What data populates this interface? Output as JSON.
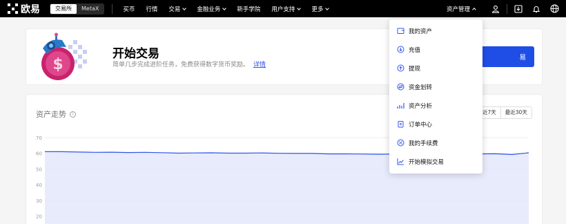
{
  "nav": {
    "logo_text": "欧易",
    "segments": [
      "交易所",
      "MetaX"
    ],
    "items": [
      {
        "label": "买币",
        "caret": false
      },
      {
        "label": "行情",
        "caret": false
      },
      {
        "label": "交易",
        "caret": true
      },
      {
        "label": "金融业务",
        "caret": true
      },
      {
        "label": "新手学院",
        "caret": false
      },
      {
        "label": "用户支持",
        "caret": true
      },
      {
        "label": "更多",
        "caret": true
      }
    ],
    "asset_menu_label": "资产管理"
  },
  "banner": {
    "title": "开始交易",
    "subtitle": "简单几步完成进阶任务，免费获得数字货币奖励。",
    "link": "详情",
    "cta_label": "易"
  },
  "chart_section": {
    "title": "资产走势",
    "info_icon": "i",
    "range_buttons": [
      "近7天",
      "最近30天"
    ]
  },
  "chart_data": {
    "type": "area",
    "title": "资产走势",
    "xlabel": "",
    "ylabel": "",
    "yticks": [
      70,
      60,
      50,
      40,
      30,
      20
    ],
    "ylim": [
      15,
      70
    ],
    "grid": true,
    "x": [
      0,
      1,
      2,
      3,
      4,
      5,
      6,
      7,
      8,
      9,
      10,
      11,
      12,
      13,
      14,
      15,
      16,
      17,
      18,
      19,
      20,
      21,
      22,
      23,
      24,
      25,
      26,
      27,
      28,
      29
    ],
    "series": [
      {
        "values": [
          61,
          61,
          60.8,
          60.6,
          60.7,
          60.5,
          60.6,
          60.4,
          60.1,
          60.2,
          60.3,
          60.1,
          60.1,
          60.2,
          60.0,
          59.9,
          59.9,
          59.6,
          59.6,
          59.5,
          59.4,
          59.5,
          59.3,
          59.4,
          59.6,
          59.4,
          59.6,
          59.7,
          59.2,
          60.3
        ]
      }
    ],
    "colors": {
      "line": "#2f54eb",
      "fill": "#e4e8fb"
    }
  },
  "dropdown": {
    "items": [
      {
        "label": "我的资产",
        "icon": "wallet-icon"
      },
      {
        "label": "充值",
        "icon": "deposit-icon"
      },
      {
        "label": "提现",
        "icon": "withdraw-icon"
      },
      {
        "label": "资金划转",
        "icon": "transfer-icon"
      },
      {
        "label": "资产分析",
        "icon": "analysis-icon"
      },
      {
        "label": "订单中心",
        "icon": "order-icon"
      },
      {
        "label": "我的手续费",
        "icon": "fee-icon"
      },
      {
        "label": "开始模拟交易",
        "icon": "demo-trading-icon"
      }
    ]
  },
  "colors": {
    "accent": "#1f4ee6",
    "nav_bg": "#000000",
    "link": "#2f54eb"
  }
}
